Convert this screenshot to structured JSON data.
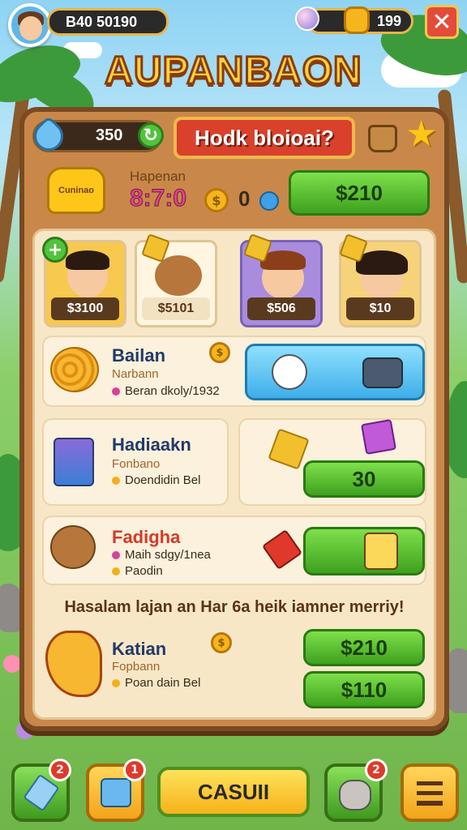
{
  "header": {
    "player_id": "B40 50190",
    "gems_count": "199",
    "title": "AUPANBAON"
  },
  "panel": {
    "energy_value": "350",
    "red_button_label": "Hodk bloioai?",
    "price_button": "$210",
    "star_badge_label": "Cuninao",
    "timer_label": "Hapenan",
    "timer_value": "8:7:0",
    "coin_small_value": "0"
  },
  "characters": [
    {
      "price": "$3100",
      "bg": "#f7c94e"
    },
    {
      "price": "$5101",
      "bg": "#fff6e2"
    },
    {
      "price": "$506",
      "bg": "#a98cde"
    },
    {
      "price": "$10",
      "bg": "#f6d37a"
    }
  ],
  "rows": [
    {
      "title": "Bailan",
      "subtitle": "Narbann",
      "note": "Beran dkoly/1932"
    },
    {
      "title": "Hadiaakn",
      "subtitle": "Fonbano",
      "note": "Doendidin Bel",
      "button": "30"
    },
    {
      "title": "Fadigha",
      "subtitle": "Maih sdgy/1nea",
      "note": "Paodin"
    },
    {
      "title": "Katian",
      "subtitle": "Fopbann",
      "note": "Poan dain Bel",
      "button_1": "$210",
      "button_2": "$110"
    }
  ],
  "banner": "Hasalam lajan an Har 6a heik iamner merriy!",
  "nav": {
    "badge_1": "2",
    "badge_2": "1",
    "badge_4": "2",
    "center_label": "CASUII"
  }
}
